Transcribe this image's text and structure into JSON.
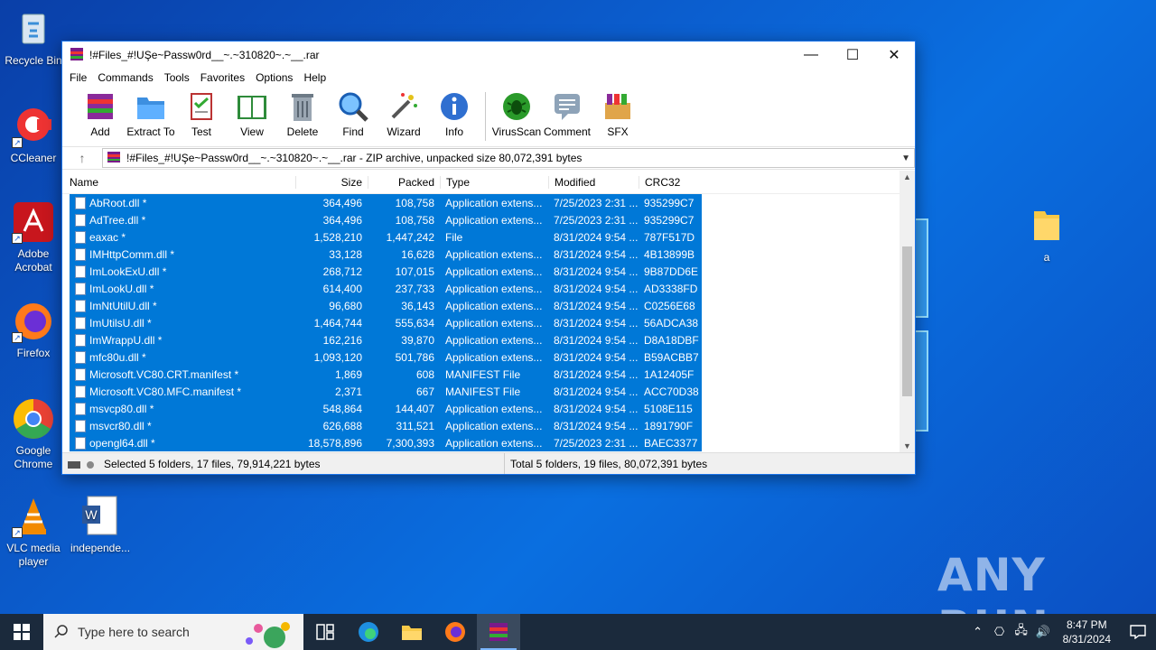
{
  "desktop": {
    "icons": [
      {
        "label": "Recycle Bin"
      },
      {
        "label": "CCleaner"
      },
      {
        "label": "Adobe Acrobat"
      },
      {
        "label": "Firefox"
      },
      {
        "label": "Google Chrome"
      },
      {
        "label": "VLC media player"
      },
      {
        "label": "independe..."
      },
      {
        "label": "a"
      }
    ]
  },
  "window": {
    "title": "!#Files_#!UŞe~Passw0rd__~.~310820~.~__.rar",
    "menu": [
      "File",
      "Commands",
      "Tools",
      "Favorites",
      "Options",
      "Help"
    ],
    "toolbar": [
      "Add",
      "Extract To",
      "Test",
      "View",
      "Delete",
      "Find",
      "Wizard",
      "Info",
      "VirusScan",
      "Comment",
      "SFX"
    ],
    "address": "!#Files_#!UŞe~Passw0rd__~.~310820~.~__.rar - ZIP archive, unpacked size 80,072,391 bytes",
    "columns": {
      "name": "Name",
      "size": "Size",
      "packed": "Packed",
      "type": "Type",
      "modified": "Modified",
      "crc": "CRC32"
    },
    "files": [
      {
        "name": "AbRoot.dll *",
        "size": "364,496",
        "packed": "108,758",
        "type": "Application extens...",
        "modified": "7/25/2023 2:31 ...",
        "crc": "935299C7"
      },
      {
        "name": "AdTree.dll *",
        "size": "364,496",
        "packed": "108,758",
        "type": "Application extens...",
        "modified": "7/25/2023 2:31 ...",
        "crc": "935299C7"
      },
      {
        "name": "eaxac *",
        "size": "1,528,210",
        "packed": "1,447,242",
        "type": "File",
        "modified": "8/31/2024 9:54 ...",
        "crc": "787F517D"
      },
      {
        "name": "IMHttpComm.dll *",
        "size": "33,128",
        "packed": "16,628",
        "type": "Application extens...",
        "modified": "8/31/2024 9:54 ...",
        "crc": "4B13899B"
      },
      {
        "name": "ImLookExU.dll *",
        "size": "268,712",
        "packed": "107,015",
        "type": "Application extens...",
        "modified": "8/31/2024 9:54 ...",
        "crc": "9B87DD6E"
      },
      {
        "name": "ImLookU.dll *",
        "size": "614,400",
        "packed": "237,733",
        "type": "Application extens...",
        "modified": "8/31/2024 9:54 ...",
        "crc": "AD3338FD"
      },
      {
        "name": "ImNtUtilU.dll *",
        "size": "96,680",
        "packed": "36,143",
        "type": "Application extens...",
        "modified": "8/31/2024 9:54 ...",
        "crc": "C0256E68"
      },
      {
        "name": "ImUtilsU.dll *",
        "size": "1,464,744",
        "packed": "555,634",
        "type": "Application extens...",
        "modified": "8/31/2024 9:54 ...",
        "crc": "56ADCA38"
      },
      {
        "name": "ImWrappU.dll *",
        "size": "162,216",
        "packed": "39,870",
        "type": "Application extens...",
        "modified": "8/31/2024 9:54 ...",
        "crc": "D8A18DBF"
      },
      {
        "name": "mfc80u.dll *",
        "size": "1,093,120",
        "packed": "501,786",
        "type": "Application extens...",
        "modified": "8/31/2024 9:54 ...",
        "crc": "B59ACBB7"
      },
      {
        "name": "Microsoft.VC80.CRT.manifest *",
        "size": "1,869",
        "packed": "608",
        "type": "MANIFEST File",
        "modified": "8/31/2024 9:54 ...",
        "crc": "1A12405F"
      },
      {
        "name": "Microsoft.VC80.MFC.manifest *",
        "size": "2,371",
        "packed": "667",
        "type": "MANIFEST File",
        "modified": "8/31/2024 9:54 ...",
        "crc": "ACC70D38"
      },
      {
        "name": "msvcp80.dll *",
        "size": "548,864",
        "packed": "144,407",
        "type": "Application extens...",
        "modified": "8/31/2024 9:54 ...",
        "crc": "5108E115"
      },
      {
        "name": "msvcr80.dll *",
        "size": "626,688",
        "packed": "311,521",
        "type": "Application extens...",
        "modified": "8/31/2024 9:54 ...",
        "crc": "1891790F"
      },
      {
        "name": "opengl64.dll *",
        "size": "18,578,896",
        "packed": "7,300,393",
        "type": "Application extens...",
        "modified": "7/25/2023 2:31 ...",
        "crc": "BAEC3377"
      }
    ],
    "status_left": "Selected 5 folders, 17 files, 79,914,221 bytes",
    "status_right": "Total 5 folders, 19 files, 80,072,391 bytes"
  },
  "taskbar": {
    "search_placeholder": "Type here to search",
    "time": "8:47 PM",
    "date": "8/31/2024"
  },
  "watermark": "ANY RUN",
  "colors": {
    "selection": "#0078d7",
    "taskbar": "#1b2a3c"
  }
}
